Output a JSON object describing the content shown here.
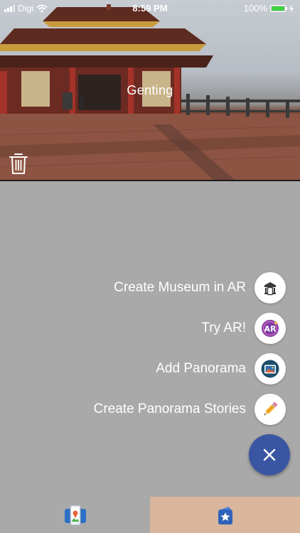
{
  "status_bar": {
    "carrier": "Digi",
    "time": "8:59 PM",
    "battery": "100%"
  },
  "hero": {
    "title": "Genting"
  },
  "speed_dial": {
    "items": [
      {
        "label": "Create Museum in AR",
        "icon": "museum-ar-icon"
      },
      {
        "label": "Try AR!",
        "icon": "ar-icon"
      },
      {
        "label": "Add Panorama",
        "icon": "panorama-icon"
      },
      {
        "label": "Create Panorama Stories",
        "icon": "pencil-icon"
      }
    ],
    "close_icon": "close-icon"
  },
  "tab_bar": {
    "tabs": [
      {
        "icon": "panorama-gallery-icon",
        "selected": false
      },
      {
        "icon": "favorites-star-icon",
        "selected": true
      }
    ]
  },
  "colors": {
    "overlay": "#a9a9a9",
    "fab": "#3a56a3",
    "selected_tab": "#d9b69c",
    "battery": "#3fd13f"
  }
}
